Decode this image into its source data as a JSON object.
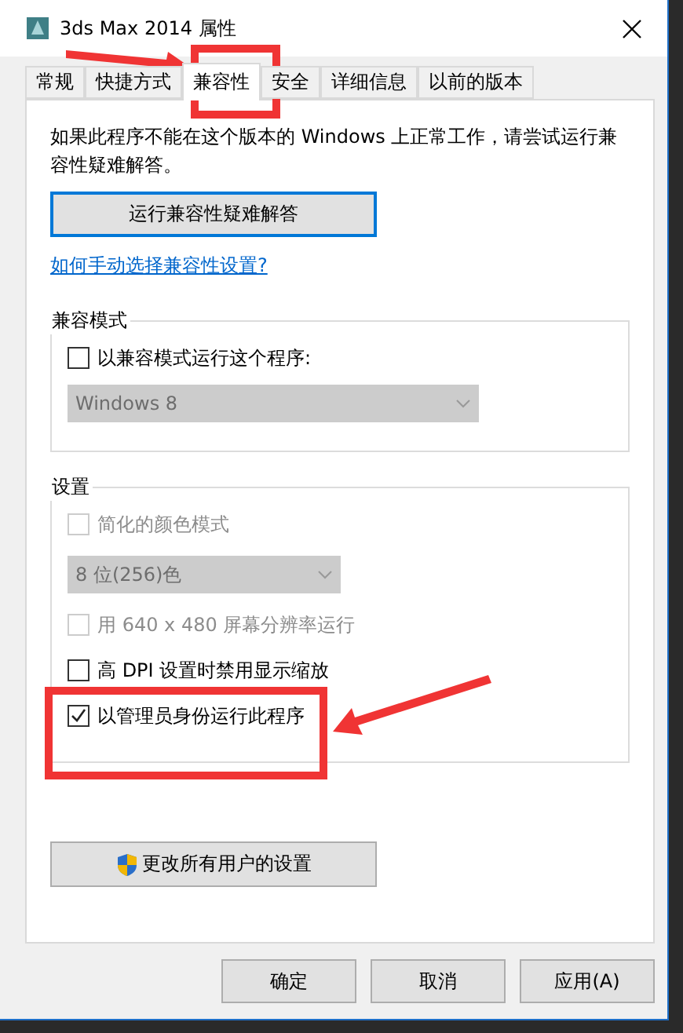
{
  "window": {
    "title": "3ds Max 2014 属性"
  },
  "tabs": [
    {
      "label": "常规",
      "selected": false
    },
    {
      "label": "快捷方式",
      "selected": false
    },
    {
      "label": "兼容性",
      "selected": true
    },
    {
      "label": "安全",
      "selected": false
    },
    {
      "label": "详细信息",
      "selected": false
    },
    {
      "label": "以前的版本",
      "selected": false
    }
  ],
  "intro": "如果此程序不能在这个版本的 Windows 上正常工作，请尝试运行兼容性疑难解答。",
  "troubleshoot_button": "运行兼容性疑难解答",
  "help_link": "如何手动选择兼容性设置?",
  "compat_mode": {
    "title": "兼容模式",
    "items": [
      {
        "kind": "checkbox",
        "label": "以兼容模式运行这个程序:",
        "checked": false,
        "disabled": false
      },
      {
        "kind": "dropdown",
        "value": "Windows 8",
        "disabled": true
      }
    ]
  },
  "settings": {
    "title": "设置",
    "items": [
      {
        "kind": "checkbox",
        "label": "简化的颜色模式",
        "checked": false,
        "disabled": true
      },
      {
        "kind": "dropdown",
        "value": "8 位(256)色",
        "disabled": true
      },
      {
        "kind": "checkbox",
        "label": "用 640 x 480 屏幕分辨率运行",
        "checked": false,
        "disabled": true
      },
      {
        "kind": "checkbox",
        "label": "高 DPI 设置时禁用显示缩放",
        "checked": false,
        "disabled": false
      },
      {
        "kind": "checkbox",
        "label": "以管理员身份运行此程序",
        "checked": true,
        "disabled": false
      }
    ]
  },
  "all_users_button": "更改所有用户的设置",
  "buttons": [
    "确定",
    "取消",
    "应用(A)"
  ]
}
